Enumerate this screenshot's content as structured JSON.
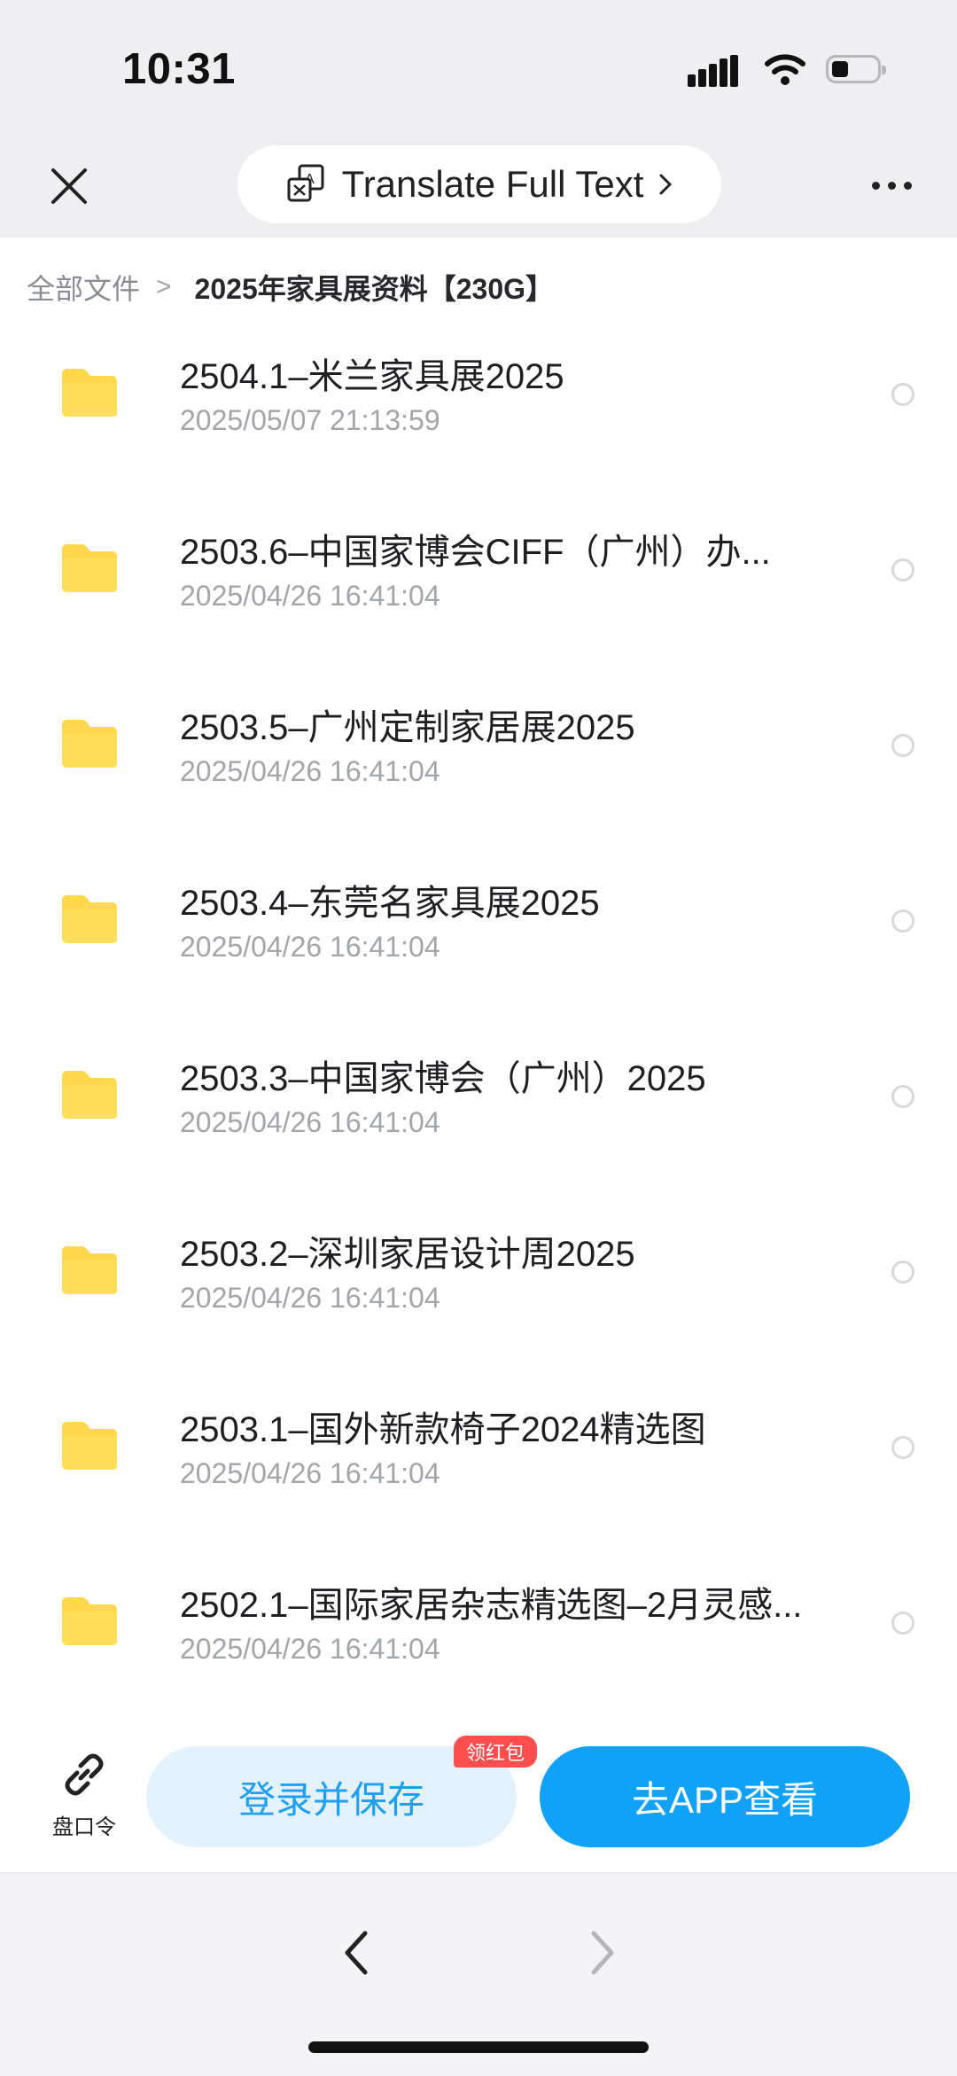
{
  "status_bar": {
    "time": "10:31"
  },
  "top_bar": {
    "close_icon": "close-icon",
    "translate_label": "Translate Full Text",
    "more_icon": "more-icon"
  },
  "breadcrumb": {
    "root": "全部文件",
    "separator": ">",
    "current": "2025年家具展资料【230G】"
  },
  "files": [
    {
      "name": "2504.1–米兰家具展2025",
      "date": "2025/05/07 21:13:59"
    },
    {
      "name": "2503.6–中国家博会CIFF（广州）办...",
      "date": "2025/04/26 16:41:04"
    },
    {
      "name": "2503.5–广州定制家居展2025",
      "date": "2025/04/26 16:41:04"
    },
    {
      "name": "2503.4–东莞名家具展2025",
      "date": "2025/04/26 16:41:04"
    },
    {
      "name": "2503.3–中国家博会（广州）2025",
      "date": "2025/04/26 16:41:04"
    },
    {
      "name": "2503.2–深圳家居设计周2025",
      "date": "2025/04/26 16:41:04"
    },
    {
      "name": "2503.1–国外新款椅子2024精选图",
      "date": "2025/04/26 16:41:04"
    },
    {
      "name": "2502.1–国际家居杂志精选图–2月灵感...",
      "date": "2025/04/26 16:41:04"
    }
  ],
  "actions": {
    "share_code_label": "盘口令",
    "login_save_label": "登录并保存",
    "badge_label": "领红包",
    "open_app_label": "去APP查看"
  },
  "colors": {
    "folder": "#ffd84d",
    "primary": "#0fa2f8",
    "light_button": "#e3f2fd",
    "badge": "#ff4e4e"
  }
}
